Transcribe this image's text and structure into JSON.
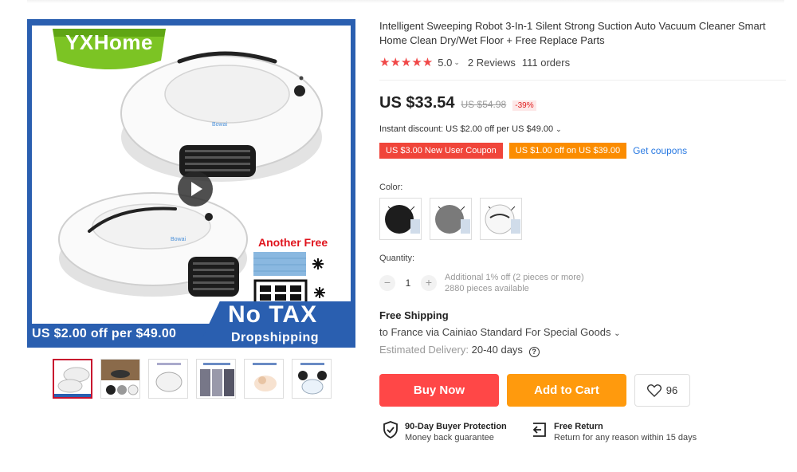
{
  "product": {
    "title": "Intelligent Sweeping Robot 3-In-1 Silent Strong Suction Auto Vacuum Cleaner Smart Home Clean Dry/Wet Floor + Free Replace Parts",
    "rating": {
      "stars": "★★★★★",
      "value": "5.0",
      "reviews": "2 Reviews",
      "orders": "111 orders"
    },
    "price": {
      "current": "US $33.54",
      "original": "US $54.98",
      "discount": "-39%"
    },
    "instant_discount": "Instant discount: US $2.00 off per US $49.00",
    "coupons": {
      "new_user": "US $3.00 New User Coupon",
      "store": "US $1.00 off on US $39.00",
      "get_link": "Get coupons"
    },
    "color": {
      "label": "Color:",
      "options": [
        "black",
        "gray",
        "white"
      ]
    },
    "quantity": {
      "label": "Quantity:",
      "value": "1",
      "minus": "−",
      "plus": "+",
      "info_line1": "Additional 1% off (2 pieces or more)",
      "info_line2": "2880 pieces available"
    },
    "shipping": {
      "title": "Free Shipping",
      "to": "to France via Cainiao Standard For Special Goods",
      "estimated_label": "Estimated Delivery:",
      "estimated_value": "20-40 days"
    },
    "actions": {
      "buy_now": "Buy Now",
      "add_to_cart": "Add to Cart",
      "wishlist_count": "96"
    },
    "guarantees": {
      "protection_title": "90-Day Buyer Protection",
      "protection_sub": "Money back guarantee",
      "return_title": "Free Return",
      "return_sub": "Return for any reason within 15 days"
    }
  },
  "gallery": {
    "brand": "YXHome",
    "another_free": "Another Free",
    "banner_discount": "US $2.00 off per $49.00",
    "no_tax": "No TAX",
    "dropshipping": "Dropshipping",
    "thumbnail_count": 6
  },
  "colors": {
    "accent_red": "#ff4747",
    "accent_orange": "#ff9a0d",
    "banner_blue": "#2a5fb0",
    "brand_green": "#7cc424",
    "link_blue": "#2a7ae2"
  }
}
